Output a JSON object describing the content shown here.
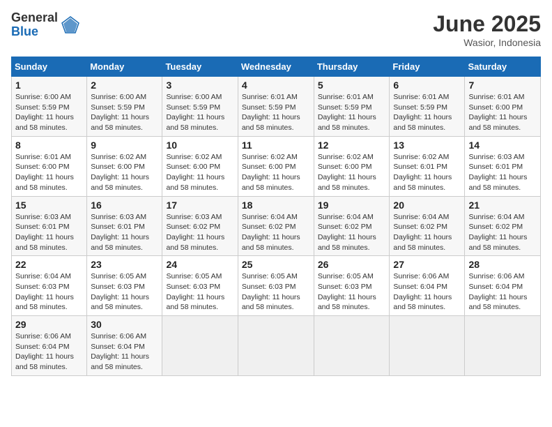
{
  "header": {
    "logo_general": "General",
    "logo_blue": "Blue",
    "month_title": "June 2025",
    "location": "Wasior, Indonesia"
  },
  "calendar": {
    "days_of_week": [
      "Sunday",
      "Monday",
      "Tuesday",
      "Wednesday",
      "Thursday",
      "Friday",
      "Saturday"
    ],
    "weeks": [
      [
        null,
        {
          "day": 2,
          "sunrise": "6:00 AM",
          "sunset": "5:59 PM",
          "daylight": "11 hours and 58 minutes."
        },
        {
          "day": 3,
          "sunrise": "6:00 AM",
          "sunset": "5:59 PM",
          "daylight": "11 hours and 58 minutes."
        },
        {
          "day": 4,
          "sunrise": "6:01 AM",
          "sunset": "5:59 PM",
          "daylight": "11 hours and 58 minutes."
        },
        {
          "day": 5,
          "sunrise": "6:01 AM",
          "sunset": "5:59 PM",
          "daylight": "11 hours and 58 minutes."
        },
        {
          "day": 6,
          "sunrise": "6:01 AM",
          "sunset": "5:59 PM",
          "daylight": "11 hours and 58 minutes."
        },
        {
          "day": 7,
          "sunrise": "6:01 AM",
          "sunset": "6:00 PM",
          "daylight": "11 hours and 58 minutes."
        }
      ],
      [
        {
          "day": 1,
          "sunrise": "6:00 AM",
          "sunset": "5:59 PM",
          "daylight": "11 hours and 58 minutes."
        },
        {
          "day": 8,
          "sunrise": "6:01 AM",
          "sunset": "6:00 PM",
          "daylight": "11 hours and 58 minutes."
        },
        {
          "day": 9,
          "sunrise": "6:02 AM",
          "sunset": "6:00 PM",
          "daylight": "11 hours and 58 minutes."
        },
        {
          "day": 10,
          "sunrise": "6:02 AM",
          "sunset": "6:00 PM",
          "daylight": "11 hours and 58 minutes."
        },
        {
          "day": 11,
          "sunrise": "6:02 AM",
          "sunset": "6:00 PM",
          "daylight": "11 hours and 58 minutes."
        },
        {
          "day": 12,
          "sunrise": "6:02 AM",
          "sunset": "6:00 PM",
          "daylight": "11 hours and 58 minutes."
        },
        {
          "day": 13,
          "sunrise": "6:02 AM",
          "sunset": "6:01 PM",
          "daylight": "11 hours and 58 minutes."
        }
      ],
      [
        {
          "day": 14,
          "sunrise": "6:03 AM",
          "sunset": "6:01 PM",
          "daylight": "11 hours and 58 minutes."
        },
        {
          "day": 15,
          "sunrise": "6:03 AM",
          "sunset": "6:01 PM",
          "daylight": "11 hours and 58 minutes."
        },
        {
          "day": 16,
          "sunrise": "6:03 AM",
          "sunset": "6:01 PM",
          "daylight": "11 hours and 58 minutes."
        },
        {
          "day": 17,
          "sunrise": "6:03 AM",
          "sunset": "6:02 PM",
          "daylight": "11 hours and 58 minutes."
        },
        {
          "day": 18,
          "sunrise": "6:04 AM",
          "sunset": "6:02 PM",
          "daylight": "11 hours and 58 minutes."
        },
        {
          "day": 19,
          "sunrise": "6:04 AM",
          "sunset": "6:02 PM",
          "daylight": "11 hours and 58 minutes."
        },
        {
          "day": 20,
          "sunrise": "6:04 AM",
          "sunset": "6:02 PM",
          "daylight": "11 hours and 58 minutes."
        }
      ],
      [
        {
          "day": 21,
          "sunrise": "6:04 AM",
          "sunset": "6:02 PM",
          "daylight": "11 hours and 58 minutes."
        },
        {
          "day": 22,
          "sunrise": "6:04 AM",
          "sunset": "6:03 PM",
          "daylight": "11 hours and 58 minutes."
        },
        {
          "day": 23,
          "sunrise": "6:05 AM",
          "sunset": "6:03 PM",
          "daylight": "11 hours and 58 minutes."
        },
        {
          "day": 24,
          "sunrise": "6:05 AM",
          "sunset": "6:03 PM",
          "daylight": "11 hours and 58 minutes."
        },
        {
          "day": 25,
          "sunrise": "6:05 AM",
          "sunset": "6:03 PM",
          "daylight": "11 hours and 58 minutes."
        },
        {
          "day": 26,
          "sunrise": "6:05 AM",
          "sunset": "6:03 PM",
          "daylight": "11 hours and 58 minutes."
        },
        {
          "day": 27,
          "sunrise": "6:06 AM",
          "sunset": "6:04 PM",
          "daylight": "11 hours and 58 minutes."
        }
      ],
      [
        {
          "day": 28,
          "sunrise": "6:06 AM",
          "sunset": "6:04 PM",
          "daylight": "11 hours and 58 minutes."
        },
        {
          "day": 29,
          "sunrise": "6:06 AM",
          "sunset": "6:04 PM",
          "daylight": "11 hours and 58 minutes."
        },
        {
          "day": 30,
          "sunrise": "6:06 AM",
          "sunset": "6:04 PM",
          "daylight": "11 hours and 58 minutes."
        },
        null,
        null,
        null,
        null
      ]
    ]
  }
}
